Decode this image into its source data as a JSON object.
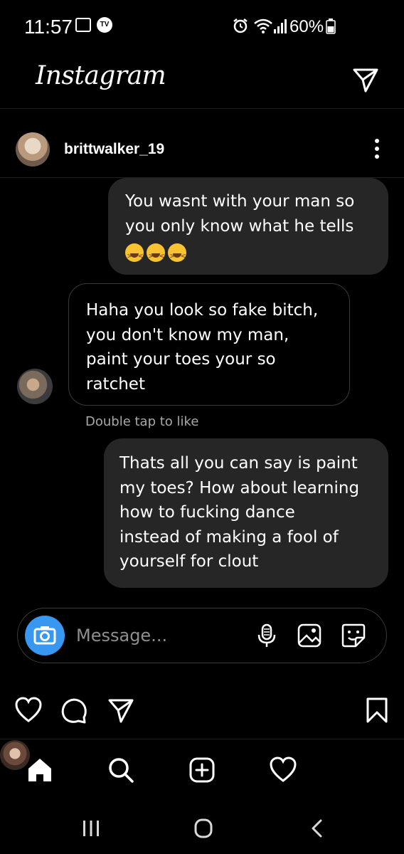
{
  "status_bar": {
    "time": "11:57",
    "tv_badge": "TV",
    "battery": "60%",
    "icons": [
      "gallery-icon",
      "tv-icon",
      "alarm-icon",
      "wifi-icon",
      "signal-icon",
      "battery-icon"
    ]
  },
  "header": {
    "logo": "Instagram",
    "icons": [
      "direct-message-icon"
    ]
  },
  "post": {
    "username": "brittwalker_19",
    "icons": [
      "more-options-icon"
    ]
  },
  "chat": {
    "messages": [
      {
        "direction": "outgoing",
        "lines": [
          "You wasnt with your man so",
          "you only know what he tells"
        ],
        "emoji": [
          "grinning-squinting-face",
          "grinning-squinting-face",
          "grinning-squinting-face"
        ]
      },
      {
        "direction": "incoming",
        "lines": [
          "Haha you look so fake bitch,",
          "you don't know my man,",
          "paint your toes your so",
          "ratchet"
        ]
      },
      {
        "direction": "outgoing",
        "lines": [
          "Thats all you can say is paint",
          "my toes? How about learning",
          "how to fucking dance",
          "instead of making a fool of",
          "yourself for clout"
        ]
      }
    ],
    "hint": "Double tap to like"
  },
  "composer": {
    "placeholder": "Message..."
  },
  "theme": {
    "background": "#000000",
    "bubble": "#262626",
    "accent": "#3897f0",
    "muted": "#a8a8a8"
  }
}
